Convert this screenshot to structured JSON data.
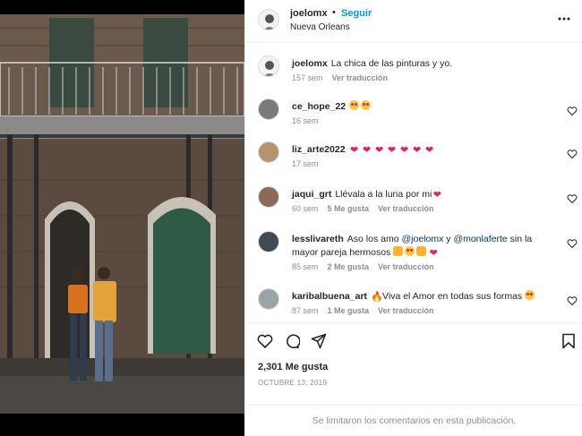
{
  "post": {
    "author": "joelomx",
    "separator": "•",
    "follow_label": "Seguir",
    "location": "Nueva Orleans",
    "caption": {
      "user": "joelomx",
      "text": "La chica de las pinturas y yo.",
      "time": "157 sem",
      "translate_label": "Ver traducción"
    }
  },
  "comments": [
    {
      "user": "ce_hope_22",
      "text": "",
      "emoji": [
        "eyes",
        "eyes"
      ],
      "time": "16 sem",
      "likes": "",
      "translate": ""
    },
    {
      "user": "liz_arte2022",
      "text": "",
      "emoji": [
        "heart",
        "heart",
        "heart",
        "heart",
        "heart",
        "heart",
        "heart"
      ],
      "time": "17 sem",
      "likes": "",
      "translate": ""
    },
    {
      "user": "jaqui_grt",
      "text": "Llévala a la luna por mi",
      "emoji": [
        "heart"
      ],
      "time": "60 sem",
      "likes": "5 Me gusta",
      "translate": "Ver traducción"
    },
    {
      "user": "lesslivareth",
      "text_pre": "Aso los amo ",
      "mention1": "@joelomx",
      "text_mid": " y ",
      "mention2": "@monlaferte",
      "text_post": " sin la mayor pareja hermosos",
      "emoji": [
        "clap",
        "eyes",
        "clap",
        "heart"
      ],
      "time": "85 sem",
      "likes": "2 Me gusta",
      "translate": "Ver traducción"
    },
    {
      "user": "karibalbuena_art",
      "text": "Viva el Amor en todas sus formas",
      "emoji_pre": [
        "fire"
      ],
      "emoji": [
        "eyes"
      ],
      "time": "87 sem",
      "likes": "1 Me gusta",
      "translate": "Ver traducción"
    }
  ],
  "likes_label": "2,301 Me gusta",
  "date_label": "OCTUBRE 13, 2019",
  "comments_limited": "Se limitaron los comentarios en esta publicación.",
  "icons": {
    "more": "more-options-icon",
    "like": "heart-icon",
    "comment": "comment-icon",
    "share": "share-icon",
    "save": "bookmark-icon"
  }
}
